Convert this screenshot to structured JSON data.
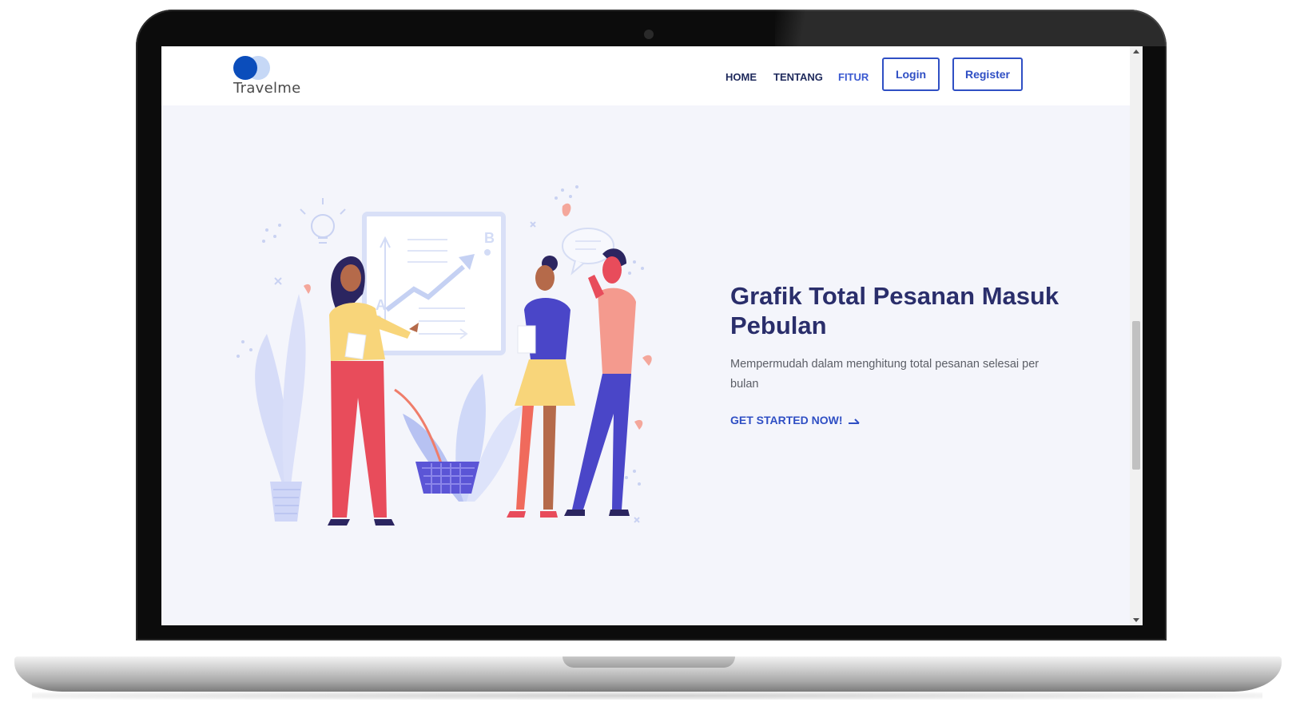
{
  "brand": {
    "name": "Travelme"
  },
  "nav": {
    "links": [
      {
        "label": "HOME"
      },
      {
        "label": "TENTANG"
      },
      {
        "label": "FITUR"
      }
    ],
    "login_label": "Login",
    "register_label": "Register"
  },
  "hero": {
    "title": "Grafik Total Pesanan Masuk Pebulan",
    "subtitle": "Mempermudah dalam menghitung total pesanan selesai per bulan",
    "cta_label": "GET STARTED NOW!",
    "board_labels": {
      "a": "A",
      "b": "B"
    }
  },
  "colors": {
    "accent": "#2f4fc4",
    "title": "#2a2e6b",
    "background": "#f4f5fb",
    "logo_primary": "#0b4dbb",
    "logo_secondary": "#c6d8f6"
  },
  "icons": {
    "cta": "arrow-right-icon"
  }
}
